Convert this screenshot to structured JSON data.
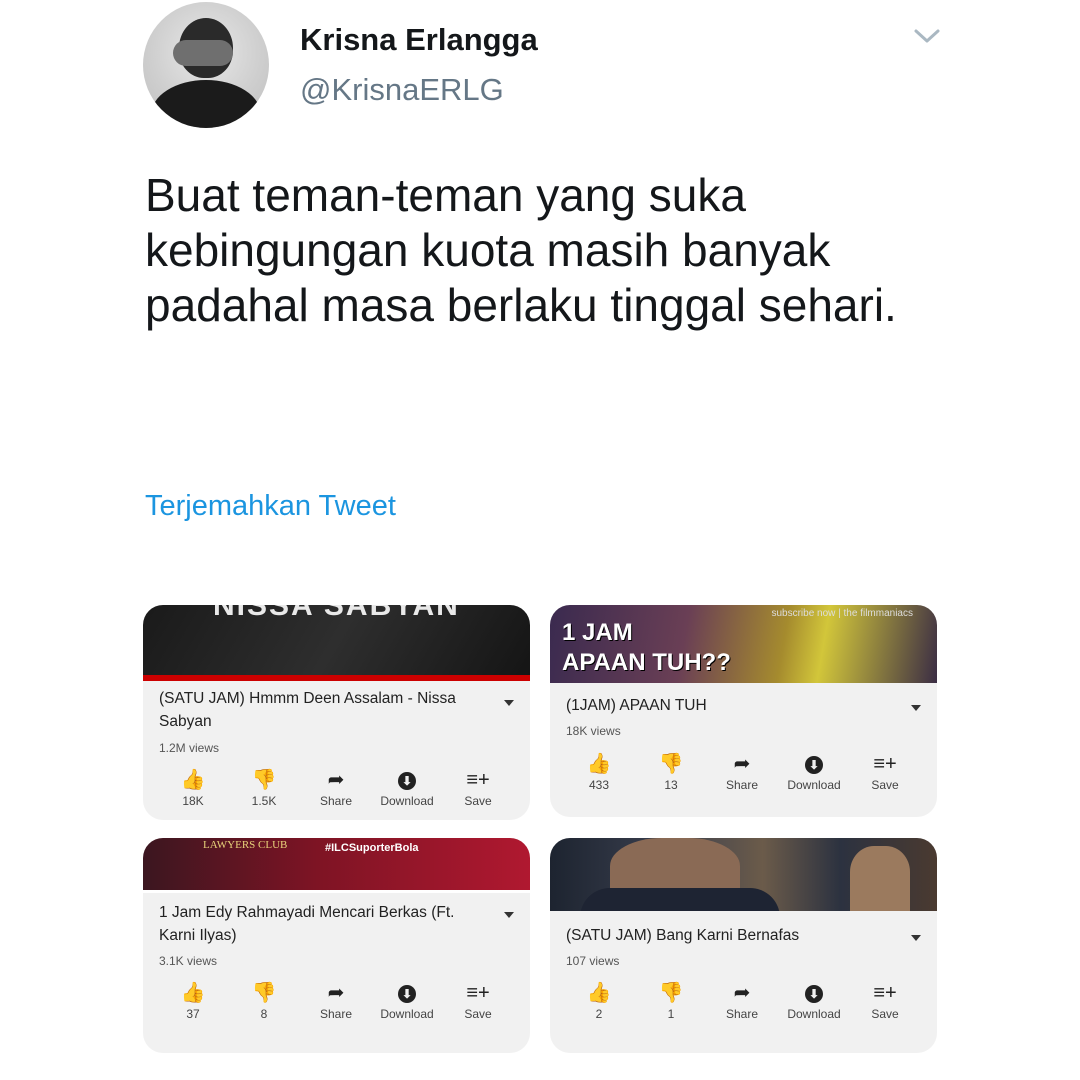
{
  "tweet": {
    "name": "Krisna Erlangga",
    "handle": "@KrisnaERLG",
    "text": "Buat teman-teman yang suka kebingungan kuota masih banyak padahal masa berlaku tinggal sehari.",
    "translate": "Terjemahkan Tweet"
  },
  "icons": {
    "like": "👍",
    "dislike": "👎",
    "share": "➦",
    "download": "⬇",
    "save": "≡+",
    "chevron": "chevron-down-icon"
  },
  "colors": {
    "link": "#1b95e0",
    "name": "#14171a",
    "handle": "#657786"
  },
  "videos": [
    {
      "thumb_text": "NISSA SABYAN",
      "title": "(SATU JAM) Hmmm Deen Assalam - Nissa Sabyan",
      "views": "1.2M views",
      "likes": "18K",
      "dislikes": "1.5K",
      "share": "Share",
      "download": "Download",
      "save": "Save"
    },
    {
      "thumb_text_1": "1 JAM",
      "thumb_text_2": "APAAN TUH??",
      "thumb_small": "subscribe now | the filmmaniacs",
      "title": "(1JAM) APAAN TUH",
      "views": "18K views",
      "likes": "433",
      "dislikes": "13",
      "share": "Share",
      "download": "Download",
      "save": "Save"
    },
    {
      "thumb_text": "#ILCSuporterBola",
      "thumb_logo": "LAWYERS CLUB",
      "title": "1 Jam Edy Rahmayadi Mencari Berkas (Ft. Karni Ilyas)",
      "views": "3.1K views",
      "likes": "37",
      "dislikes": "8",
      "share": "Share",
      "download": "Download",
      "save": "Save"
    },
    {
      "title": "(SATU JAM) Bang Karni Bernafas",
      "views": "107 views",
      "likes": "2",
      "dislikes": "1",
      "share": "Share",
      "download": "Download",
      "save": "Save"
    }
  ]
}
